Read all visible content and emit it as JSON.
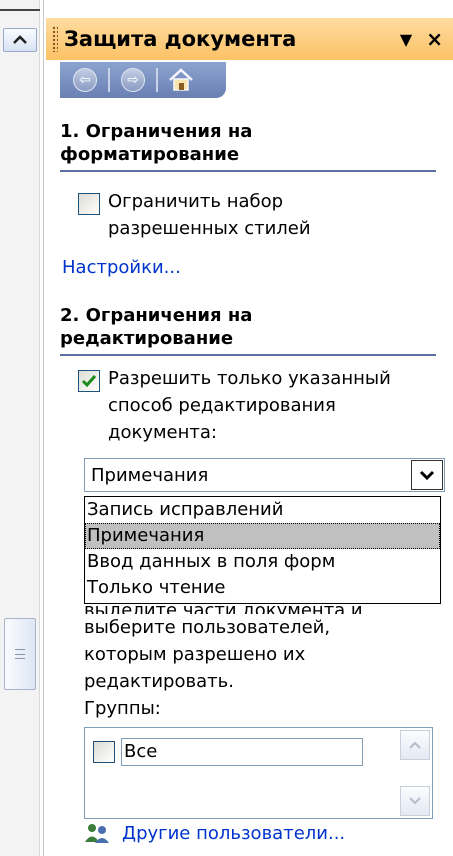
{
  "panel": {
    "title": "Защита документа",
    "menu_glyph": "▼",
    "close_glyph": "×"
  },
  "nav": {
    "back_glyph": "⇦",
    "forward_glyph": "⇨",
    "home_icon": "home-icon"
  },
  "section1": {
    "heading_line1": "1. Ограничения на",
    "heading_line2": "форматирование",
    "checkbox_checked": false,
    "checkbox_label_line1": "Ограничить набор",
    "checkbox_label_line2": "разрешенных стилей",
    "settings_link": "Настройки..."
  },
  "section2": {
    "heading_line1": "2. Ограничения на",
    "heading_line2": "редактирование",
    "checkbox_checked": true,
    "checkbox_label_line1": "Разрешить только указанный",
    "checkbox_label_line2": "способ редактирования",
    "checkbox_label_line3": "документа:",
    "combo_value": "Примечания",
    "dropdown_options": [
      "Запись исправлений",
      "Примечания",
      "Ввод данных в поля форм",
      "Только чтение"
    ],
    "dropdown_selected_index": 1,
    "partial_line": "выделите части документа и",
    "text_line1": "выберите пользователей,",
    "text_line2": "которым разрешено их",
    "text_line3": "редактировать.",
    "groups_label": "Группы:",
    "groups_item": "Все",
    "other_users_link": "Другие пользователи..."
  },
  "colors": {
    "title_bg": "#fbc266",
    "nav_bg": "#6a80b3",
    "link": "#0033cc",
    "heading_rule": "#5b6fa3",
    "check": "#1a8a1a"
  }
}
